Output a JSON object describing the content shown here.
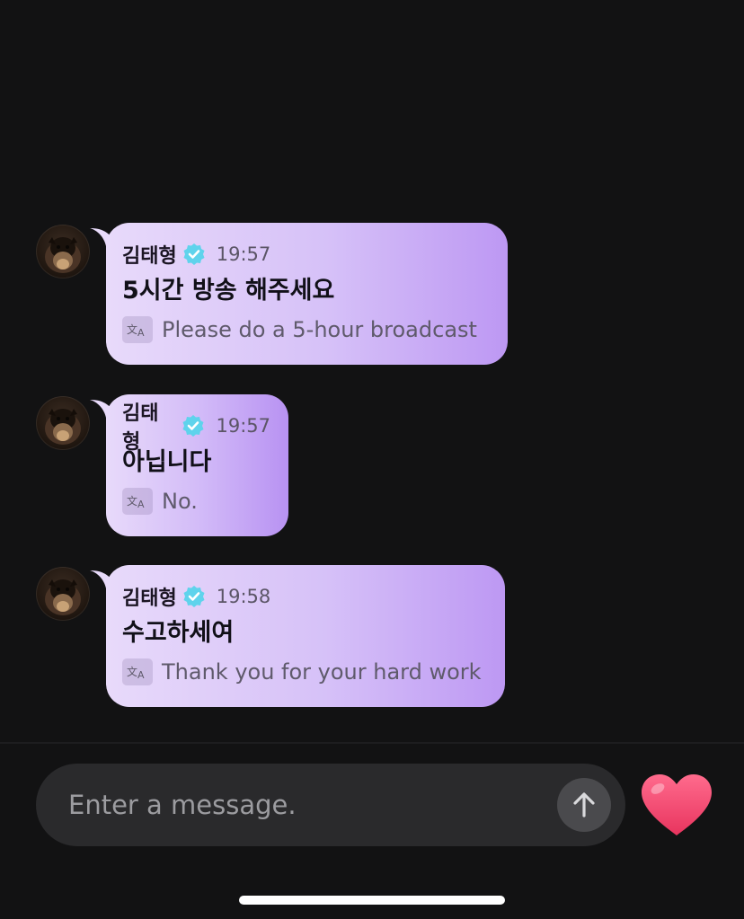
{
  "messages": [
    {
      "sender": "김태형",
      "time": "19:57",
      "text": "5시간 방송 해주세요",
      "translation": "Please do a 5-hour broadcast"
    },
    {
      "sender": "김태형",
      "time": "19:57",
      "text": "아닙니다",
      "translation": "No."
    },
    {
      "sender": "김태형",
      "time": "19:58",
      "text": "수고하세여",
      "translation": "Thank you for your hard work"
    }
  ],
  "composer": {
    "placeholder": "Enter a message.",
    "send_icon": "arrow-up-icon",
    "reaction_icon": "heart-icon"
  },
  "colors": {
    "background": "#121213",
    "bubble_start": "#e8dafa",
    "bubble_end": "#bd98f3",
    "verified": "#5fd3ec",
    "heart": "#f0426b",
    "input_bg": "#2a2a2c"
  }
}
